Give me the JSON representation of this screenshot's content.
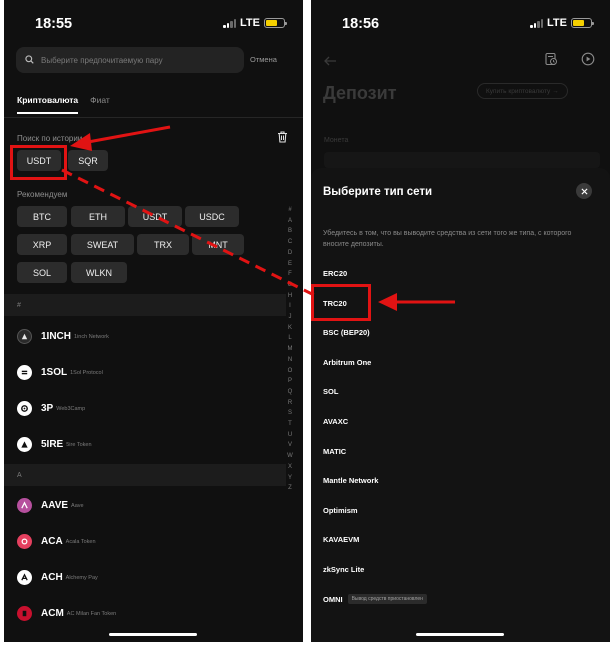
{
  "left_phone": {
    "time": "18:55",
    "network": "LTE",
    "search": {
      "placeholder": "Выберите предпочитаемую пару"
    },
    "cancel_label": "Отмена",
    "tabs": [
      {
        "label": "Криптовалюта",
        "active": true
      },
      {
        "label": "Фиат",
        "active": false
      }
    ],
    "history_label": "Поиск по истории",
    "history_chips": [
      "USDT",
      "SQR"
    ],
    "recommend_label": "Рекомендуем",
    "recommend_chips": [
      "BTC",
      "ETH",
      "USDT",
      "USDC",
      "XRP",
      "SWEAT",
      "TRX",
      "MNT",
      "SOL",
      "WLKN"
    ],
    "alpha_index": [
      "#",
      "A",
      "B",
      "C",
      "D",
      "E",
      "F",
      "G",
      "H",
      "I",
      "J",
      "K",
      "L",
      "M",
      "N",
      "O",
      "P",
      "Q",
      "R",
      "S",
      "T",
      "U",
      "V",
      "W",
      "X",
      "Y",
      "Z"
    ],
    "sections": [
      {
        "header": "#",
        "coins": [
          {
            "symbol": "1INCH",
            "name": "1inch Network",
            "icon": "1inch-logo-icon",
            "color": "#ffffff"
          },
          {
            "symbol": "1SOL",
            "name": "1Sol Protocol",
            "icon": "1sol-logo-icon",
            "color": "#ffffff"
          },
          {
            "symbol": "3P",
            "name": "Web3Camp",
            "icon": "3p-logo-icon",
            "color": "#ffffff"
          },
          {
            "symbol": "5IRE",
            "name": "5ire Token",
            "icon": "5ire-logo-icon",
            "color": "#ffffff"
          }
        ]
      },
      {
        "header": "A",
        "coins": [
          {
            "symbol": "AAVE",
            "name": "Aave",
            "icon": "aave-logo-icon",
            "color": "#b6509e"
          },
          {
            "symbol": "ACA",
            "name": "Acala Token",
            "icon": "aca-logo-icon",
            "color": "#e4405f"
          },
          {
            "symbol": "ACH",
            "name": "Alchemy Pay",
            "icon": "ach-logo-icon",
            "color": "#ffffff"
          },
          {
            "symbol": "ACM",
            "name": "AC Milan Fan Token",
            "icon": "acm-logo-icon",
            "color": "#c8102e"
          }
        ]
      }
    ]
  },
  "right_phone": {
    "time": "18:56",
    "network": "LTE",
    "title": "Депозит",
    "buy_crypto_label": "Купить криптовалюту →",
    "coin_label": "Монета",
    "sheet": {
      "title": "Выберите тип сети",
      "note": "Убедитесь в том, что вы выводите средства из сети того же типа, с которого вносите депозиты.",
      "networks": [
        {
          "label": "ERC20"
        },
        {
          "label": "TRC20"
        },
        {
          "label": "BSC (BEP20)"
        },
        {
          "label": "Arbitrum One"
        },
        {
          "label": "SOL"
        },
        {
          "label": "AVAXC"
        },
        {
          "label": "MATIC"
        },
        {
          "label": "Mantle Network"
        },
        {
          "label": "Optimism"
        },
        {
          "label": "KAVAEVM"
        },
        {
          "label": "zkSync Lite"
        },
        {
          "label": "OMNI",
          "badge": "Вывод средств приостановлен"
        }
      ]
    }
  },
  "annotation_color": "#e11313"
}
